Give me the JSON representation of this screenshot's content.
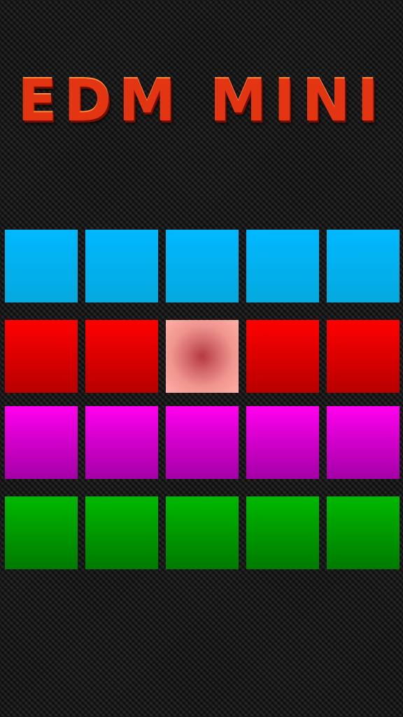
{
  "app": {
    "title": "EDM MINI"
  },
  "colors": {
    "blue": "#00b8ff",
    "red": "#ff0000",
    "magenta": "#ff00ee",
    "green": "#00b800",
    "active_pad": "#f0958f",
    "title": "#e33512"
  },
  "pad_grid": {
    "rows": [
      {
        "color": "blue",
        "pads": [
          {
            "active": false
          },
          {
            "active": false
          },
          {
            "active": false
          },
          {
            "active": false
          },
          {
            "active": false
          }
        ]
      },
      {
        "color": "red",
        "pads": [
          {
            "active": false
          },
          {
            "active": false
          },
          {
            "active": true
          },
          {
            "active": false
          },
          {
            "active": false
          }
        ]
      },
      {
        "color": "magenta",
        "pads": [
          {
            "active": false
          },
          {
            "active": false
          },
          {
            "active": false
          },
          {
            "active": false
          },
          {
            "active": false
          }
        ]
      },
      {
        "color": "green",
        "pads": [
          {
            "active": false
          },
          {
            "active": false
          },
          {
            "active": false
          },
          {
            "active": false
          },
          {
            "active": false
          }
        ]
      }
    ]
  }
}
